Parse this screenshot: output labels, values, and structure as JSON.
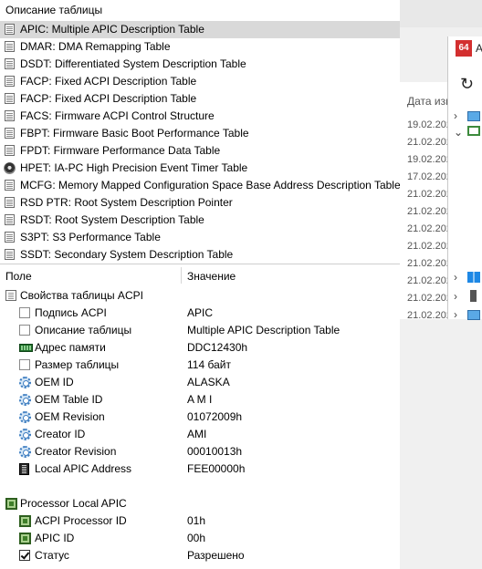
{
  "tables_panel": {
    "title": "Описание таблицы",
    "items": [
      {
        "label": "APIC: Multiple APIC Description Table",
        "selected": true,
        "icon": "table-icon"
      },
      {
        "label": "DMAR: DMA Remapping Table",
        "icon": "table-icon"
      },
      {
        "label": "DSDT: Differentiated System Description Table",
        "icon": "table-icon"
      },
      {
        "label": "FACP: Fixed ACPI Description Table",
        "icon": "table-icon"
      },
      {
        "label": "FACP: Fixed ACPI Description Table",
        "icon": "table-icon"
      },
      {
        "label": "FACS: Firmware ACPI Control Structure",
        "icon": "table-icon"
      },
      {
        "label": "FBPT: Firmware Basic Boot Performance Table",
        "icon": "table-icon"
      },
      {
        "label": "FPDT: Firmware Performance Data Table",
        "icon": "table-icon"
      },
      {
        "label": "HPET: IA-PC High Precision Event Timer Table",
        "icon": "timer-icon"
      },
      {
        "label": "MCFG: Memory Mapped Configuration Space Base Address Description Table",
        "icon": "table-icon"
      },
      {
        "label": "RSD PTR: Root System Description Pointer",
        "icon": "table-icon"
      },
      {
        "label": "RSDT: Root System Description Table",
        "icon": "table-icon"
      },
      {
        "label": "S3PT: S3 Performance Table",
        "icon": "table-icon"
      },
      {
        "label": "SSDT: Secondary System Description Table",
        "icon": "table-icon"
      }
    ]
  },
  "details": {
    "header": {
      "field": "Поле",
      "value": "Значение"
    },
    "section1": {
      "title": "Свойства таблицы ACPI",
      "rows": [
        {
          "name": "Подпись ACPI",
          "value": "APIC",
          "icon": "blank-doc-icon"
        },
        {
          "name": "Описание таблицы",
          "value": "Multiple APIC Description Table",
          "icon": "blank-doc-icon"
        },
        {
          "name": "Адрес памяти",
          "value": "DDC12430h",
          "icon": "memory-icon"
        },
        {
          "name": "Размер таблицы",
          "value": "114 байт",
          "icon": "blank-doc-icon"
        },
        {
          "name": "OEM ID",
          "value": "ALASKA",
          "icon": "gear-icon"
        },
        {
          "name": "OEM Table ID",
          "value": "A M I",
          "icon": "gear-icon"
        },
        {
          "name": "OEM Revision",
          "value": "01072009h",
          "icon": "gear-icon"
        },
        {
          "name": "Creator ID",
          "value": "AMI",
          "icon": "gear-icon"
        },
        {
          "name": "Creator Revision",
          "value": "00010013h",
          "icon": "gear-icon"
        },
        {
          "name": "Local APIC Address",
          "value": "FEE00000h",
          "icon": "chip-icon"
        }
      ]
    },
    "section2": {
      "title": "Processor Local APIC",
      "rows": [
        {
          "name": "ACPI Processor ID",
          "value": "01h",
          "icon": "cpu-icon"
        },
        {
          "name": "APIC ID",
          "value": "00h",
          "icon": "cpu-icon"
        },
        {
          "name": "Статус",
          "value": "Разрешено",
          "icon": "checkbox-icon"
        }
      ]
    }
  },
  "background_window": {
    "app_badge": "64",
    "app_title_fragment": "A",
    "column_header": "Дата изм",
    "dates": [
      "19.02.202",
      "21.02.202",
      "19.02.202",
      "17.02.202",
      "21.02.202",
      "21.02.202",
      "21.02.202",
      "21.02.202",
      "21.02.202",
      "21.02.202",
      "21.02.202",
      "21.02.202"
    ]
  }
}
